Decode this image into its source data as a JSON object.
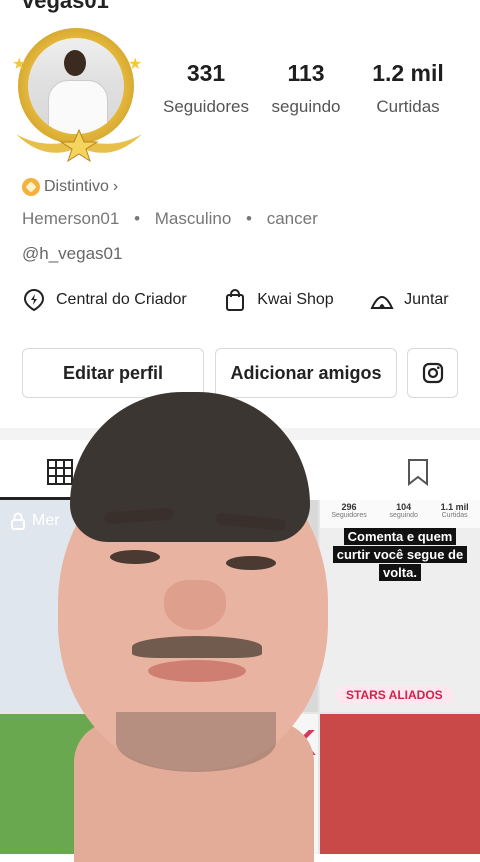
{
  "header": {
    "name_partial": "vegas01",
    "right_partial": ""
  },
  "profile": {
    "stats": [
      {
        "value": "331",
        "label": "Seguidores"
      },
      {
        "value": "113",
        "label": "seguindo"
      },
      {
        "value": "1.2 mil",
        "label": "Curtidas"
      }
    ],
    "badge_label": "Distintivo",
    "badge_chevron": "›",
    "info": {
      "name": "Hemerson01",
      "sep": "•",
      "gender": "Masculino",
      "sign": "cancer"
    },
    "handle": "@h_vegas01"
  },
  "quick_links": [
    {
      "label": "Central do Criador",
      "icon": "lightning-pin-icon"
    },
    {
      "label": "Kwai Shop",
      "icon": "shopping-bag-icon"
    },
    {
      "label": "Juntar",
      "icon": "tent-icon"
    }
  ],
  "actions": {
    "edit_label": "Editar perfil",
    "add_friends_label": "Adicionar amigos",
    "instagram_icon": "instagram-icon"
  },
  "tabs": [
    {
      "icon": "grid-icon",
      "active": true
    },
    {
      "icon": "bookmark-icon",
      "active": false
    }
  ],
  "grid": {
    "tile1_label": "Mer",
    "tile3_stats": [
      {
        "value": "296",
        "label": "Seguidores"
      },
      {
        "value": "104",
        "label": "seguindo"
      },
      {
        "value": "1.1 mil",
        "label": "Curtidas"
      }
    ],
    "tile3_caption": "Comenta e quem curtir você segue de volta.",
    "tile3_title": "STARS ALIADOS",
    "tile5_text": "1K"
  },
  "colors": {
    "badge": "#f5b13b",
    "ring_gold": "#e3b63a",
    "text_dark": "#1e1e1e",
    "text_muted": "#777777"
  }
}
